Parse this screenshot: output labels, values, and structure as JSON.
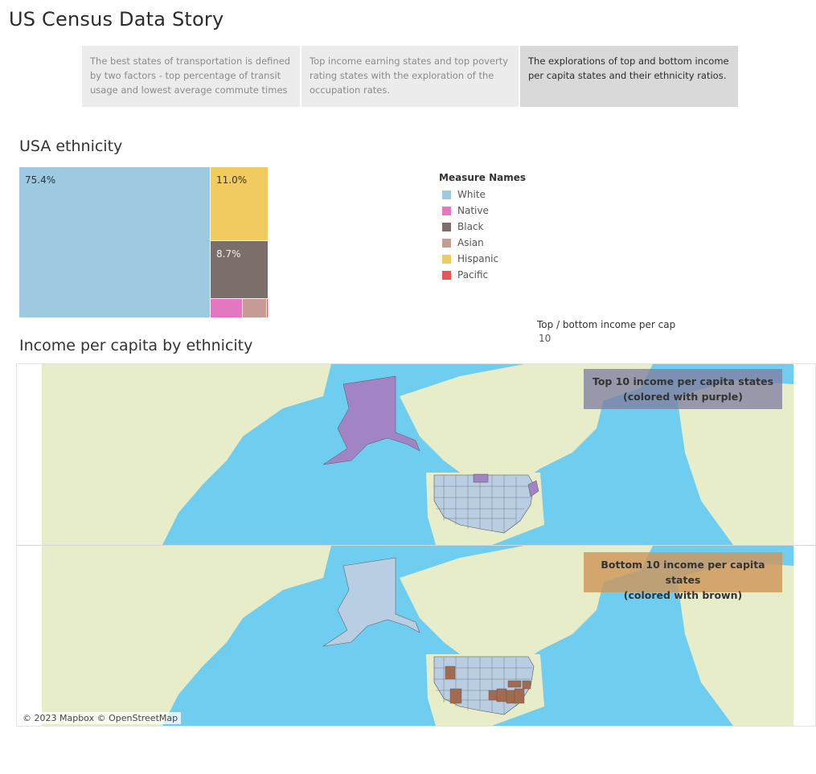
{
  "story": {
    "title": "US Census Data Story",
    "points": [
      {
        "text": "The best states of transportation is defined by two factors - top percentage of transit usage and lowest average commute times",
        "active": false
      },
      {
        "text": "Top income earning states and top poverty rating states with the exploration of the occupation rates.",
        "active": false
      },
      {
        "text": "The explorations of top and bottom income per capita states and their ethnicity ratios.",
        "active": true
      }
    ]
  },
  "ethnicity": {
    "title": "USA ethnicity",
    "legend_title": "Measure Names",
    "chart_data": {
      "type": "treemap",
      "title": "USA ethnicity",
      "labels": [
        "White",
        "Native",
        "Black",
        "Asian",
        "Hispanic",
        "Pacific"
      ],
      "values_pct_labeled": {
        "White": "75.4%",
        "Hispanic": "11.0%",
        "Black": "8.7%"
      },
      "colors": {
        "White": "#9ecae1",
        "Native": "#e377c2",
        "Black": "#7b6e6b",
        "Asian": "#c49c94",
        "Hispanic": "#f0cc60",
        "Pacific": "#e45756"
      }
    },
    "legend": [
      {
        "label": "White",
        "color": "#9ecae1"
      },
      {
        "label": "Native",
        "color": "#e377c2"
      },
      {
        "label": "Black",
        "color": "#7b6e6b"
      },
      {
        "label": "Asian",
        "color": "#c49c94"
      },
      {
        "label": "Hispanic",
        "color": "#f0cc60"
      },
      {
        "label": "Pacific",
        "color": "#e45756"
      }
    ]
  },
  "income": {
    "title": "Income per capita by ethnicity",
    "parameter": {
      "label": "Top / bottom income per cap",
      "value": "10"
    },
    "top_callout": {
      "line1": "Top 10 income per capita states",
      "line2": "(colored with purple)",
      "color": "#9b7fc0"
    },
    "bottom_callout": {
      "line1": "Bottom 10 income per capita states",
      "line2": "(colored with brown)",
      "color": "#a0694e"
    },
    "attribution": "© 2023 Mapbox © OpenStreetMap",
    "colors": {
      "ocean": "#6fcdf0",
      "land": "#e6edc8",
      "state": "#b9cde3",
      "purple": "#a283c3",
      "brown": "#a26a4e"
    }
  }
}
